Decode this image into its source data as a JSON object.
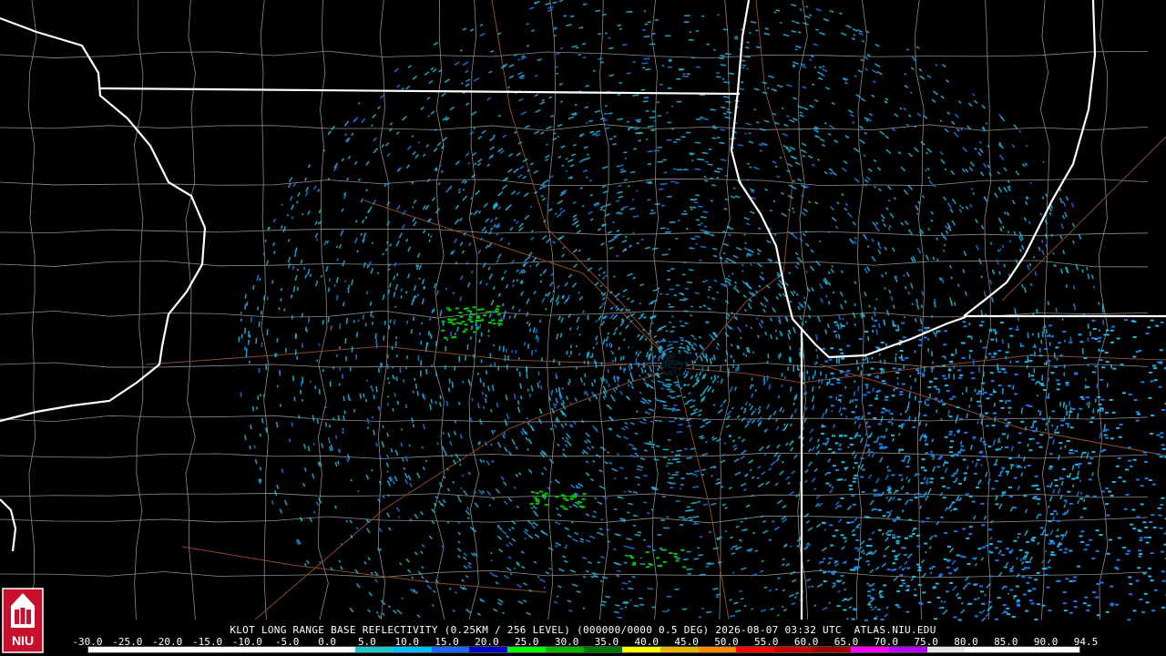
{
  "caption": "KLOT LONG RANGE BASE REFLECTIVITY (0.25KM / 256 LEVEL) (000000/0000 0.5 DEG) 2026-08-07 03:32 UTC  ATLAS.NIU.EDU",
  "scale": {
    "labels": [
      "-30.0",
      "-25.0",
      "-20.0",
      "-15.0",
      "-10.0",
      "-5.0",
      "0.0",
      "5.0",
      "10.0",
      "15.0",
      "20.0",
      "25.0",
      "30.0",
      "35.0",
      "40.0",
      "45.0",
      "50.0",
      "55.0",
      "60.0",
      "65.0",
      "70.0",
      "75.0",
      "80.0",
      "85.0",
      "90.0",
      "94.5"
    ],
    "colors": [
      "#ffffff",
      "#ffffff",
      "#ffffff",
      "#ffffff",
      "#ffffff",
      "#ffffff",
      "#ffffff",
      "#1ec8c8",
      "#00bfff",
      "#1e64ff",
      "#0000c8",
      "#00ff00",
      "#00b400",
      "#007800",
      "#ffff00",
      "#e6b400",
      "#ff8c00",
      "#ff0000",
      "#c80000",
      "#a00000",
      "#ff00ff",
      "#b400ff",
      "#e6e6e6",
      "#ffffff",
      "#ffffff",
      "#ffffff"
    ]
  },
  "logo": {
    "text": "NIU",
    "colors": {
      "shield": "#c8102e",
      "tower": "#ffffff",
      "text": "#ffffff"
    }
  },
  "map_colors": {
    "background": "#000000",
    "state_lines": "#ffffff",
    "county_lines": "#8c8c8c",
    "roads": "#8b4a2b",
    "echo_light": "#28b4dc",
    "echo_mid": "#1e78e6",
    "echo_strong": "#00c800"
  },
  "radar_center": {
    "label": "KLOT"
  }
}
